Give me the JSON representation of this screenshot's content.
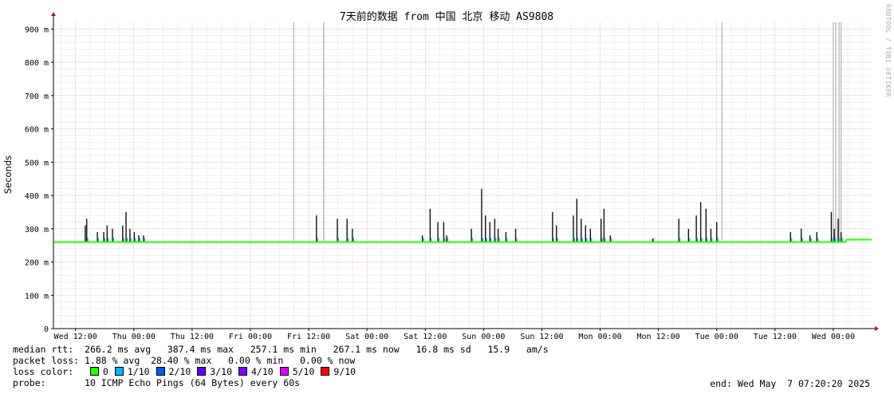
{
  "chart_data": {
    "type": "line",
    "title": "7天前的数据 from 中国 北京 移动 AS9808",
    "ylabel": "Seconds",
    "y_ticks": [
      "0",
      "100 m",
      "200 m",
      "300 m",
      "400 m",
      "500 m",
      "600 m",
      "700 m",
      "800 m",
      "900 m"
    ],
    "x_ticks": [
      "Wed 12:00",
      "Thu 00:00",
      "Thu 12:00",
      "Fri 00:00",
      "Fri 12:00",
      "Sat 00:00",
      "Sat 12:00",
      "Sun 00:00",
      "Sun 12:00",
      "Mon 00:00",
      "Mon 12:00",
      "Tue 00:00",
      "Tue 12:00",
      "Wed 00:00"
    ],
    "ylim": [
      0,
      0.92
    ],
    "x_unit": "hours since Wed 12:00",
    "xlim": [
      -4.55,
      163.9
    ],
    "grid": true,
    "median_baseline": 0.26,
    "median_segments": [
      {
        "x": [
          -4.55,
          20.2
        ],
        "y": 0.26
      },
      {
        "x": [
          20.2,
          78
        ],
        "y": 0.26
      },
      {
        "x": [
          158.6,
          163.9
        ],
        "y": 0.267
      }
    ],
    "spikes": [
      {
        "x": 2.0,
        "hi": 0.31
      },
      {
        "x": 2.3,
        "hi": 0.33
      },
      {
        "x": 4.5,
        "hi": 0.29
      },
      {
        "x": 5.8,
        "hi": 0.29
      },
      {
        "x": 6.5,
        "hi": 0.31
      },
      {
        "x": 7.6,
        "hi": 0.3
      },
      {
        "x": 9.7,
        "hi": 0.31
      },
      {
        "x": 10.4,
        "hi": 0.35
      },
      {
        "x": 11.2,
        "hi": 0.3
      },
      {
        "x": 12.1,
        "hi": 0.29
      },
      {
        "x": 13.0,
        "hi": 0.28
      },
      {
        "x": 14.0,
        "hi": 0.28
      },
      {
        "x": 49.6,
        "hi": 0.34
      },
      {
        "x": 53.9,
        "hi": 0.33
      },
      {
        "x": 55.9,
        "hi": 0.33
      },
      {
        "x": 57.0,
        "hi": 0.3
      },
      {
        "x": 71.4,
        "hi": 0.28
      },
      {
        "x": 73.0,
        "hi": 0.36
      },
      {
        "x": 74.6,
        "hi": 0.32
      },
      {
        "x": 75.8,
        "hi": 0.32
      },
      {
        "x": 76.4,
        "hi": 0.28
      },
      {
        "x": 81.5,
        "hi": 0.3
      },
      {
        "x": 83.6,
        "hi": 0.42
      },
      {
        "x": 84.4,
        "hi": 0.34
      },
      {
        "x": 85.3,
        "hi": 0.32
      },
      {
        "x": 86.3,
        "hi": 0.33
      },
      {
        "x": 87.0,
        "hi": 0.3
      },
      {
        "x": 88.6,
        "hi": 0.29
      },
      {
        "x": 90.6,
        "hi": 0.3
      },
      {
        "x": 98.2,
        "hi": 0.35
      },
      {
        "x": 99.0,
        "hi": 0.31
      },
      {
        "x": 102.5,
        "hi": 0.34
      },
      {
        "x": 103.2,
        "hi": 0.39
      },
      {
        "x": 104.1,
        "hi": 0.33
      },
      {
        "x": 105.0,
        "hi": 0.31
      },
      {
        "x": 106.0,
        "hi": 0.3
      },
      {
        "x": 108.2,
        "hi": 0.33
      },
      {
        "x": 108.8,
        "hi": 0.36
      },
      {
        "x": 110.1,
        "hi": 0.28
      },
      {
        "x": 118.8,
        "hi": 0.27
      },
      {
        "x": 124.2,
        "hi": 0.33
      },
      {
        "x": 126.2,
        "hi": 0.3
      },
      {
        "x": 127.8,
        "hi": 0.34
      },
      {
        "x": 128.7,
        "hi": 0.38
      },
      {
        "x": 129.8,
        "hi": 0.36
      },
      {
        "x": 130.8,
        "hi": 0.3
      },
      {
        "x": 132.0,
        "hi": 0.32
      },
      {
        "x": 147.2,
        "hi": 0.29
      },
      {
        "x": 149.4,
        "hi": 0.3
      },
      {
        "x": 151.2,
        "hi": 0.28
      },
      {
        "x": 152.6,
        "hi": 0.29
      },
      {
        "x": 155.6,
        "hi": 0.35
      },
      {
        "x": 156.2,
        "hi": 0.3
      },
      {
        "x": 157.0,
        "hi": 0.33
      },
      {
        "x": 157.6,
        "hi": 0.29
      }
    ],
    "loss_lines": [
      44.9,
      51.1,
      133.1,
      156.0,
      156.5,
      157.2,
      157.6
    ],
    "legend": {
      "median_label": "median rtt:",
      "median_stats": "266.2 ms avg   387.4 ms max   257.1 ms min   267.1 ms now   16.8 ms sd   15.9   am/s",
      "loss_label": "packet loss:",
      "loss_stats": "1.88 % avg  28.40 % max   0.00 % min   0.00 % now",
      "color_label": "loss color:",
      "loss_colors": [
        {
          "label": "0",
          "color": "#26ff00"
        },
        {
          "label": "1/10",
          "color": "#00b8ff"
        },
        {
          "label": "2/10",
          "color": "#0059ff"
        },
        {
          "label": "3/10",
          "color": "#5e00ff"
        },
        {
          "label": "4/10",
          "color": "#7e00ff"
        },
        {
          "label": "5/10",
          "color": "#dd00ff"
        },
        {
          "label": "9/10",
          "color": "#ff0000"
        }
      ],
      "probe_label": "probe:",
      "probe_text": "10 ICMP Echo Pings (64 Bytes) every 60s",
      "end_text": "end: Wed May  7 07:20:20 2025"
    },
    "watermark": "RRDTOOL / TOBI OETIKER"
  }
}
